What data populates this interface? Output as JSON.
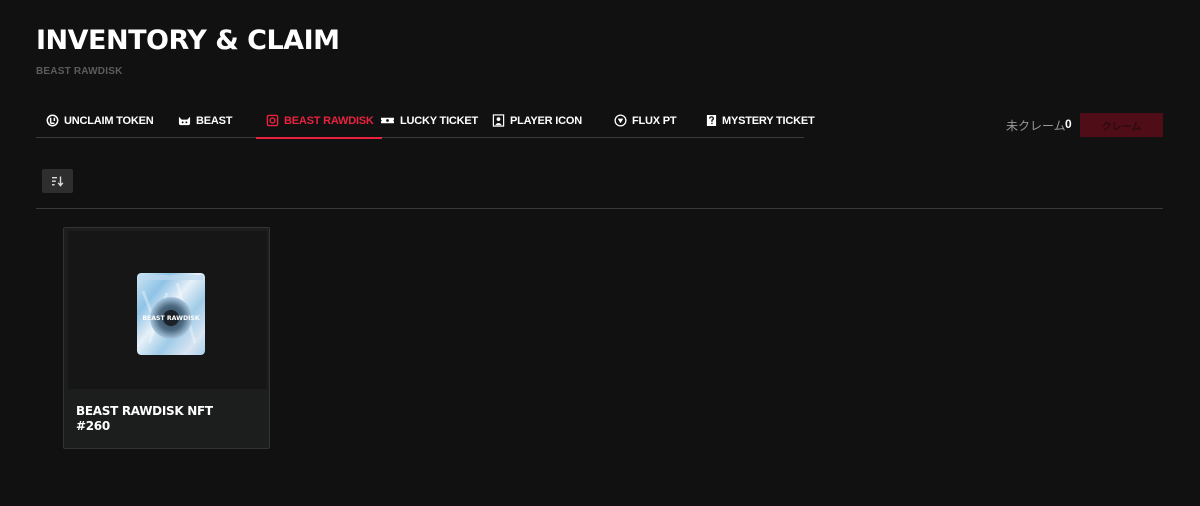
{
  "header": {
    "title": "INVENTORY & CLAIM",
    "subtitle": "BEAST RAWDISK"
  },
  "tabs": [
    {
      "label": "UNCLAIM TOKEN",
      "icon": "token-icon",
      "active": false
    },
    {
      "label": "BEAST",
      "icon": "cat-face-icon",
      "active": false
    },
    {
      "label": "BEAST RAWDISK",
      "icon": "disk-icon",
      "active": true
    },
    {
      "label": "LUCKY TICKET",
      "icon": "ticket-icon",
      "active": false
    },
    {
      "label": "PLAYER ICON",
      "icon": "player-icon",
      "active": false
    },
    {
      "label": "FLUX PT",
      "icon": "flux-icon",
      "active": false
    },
    {
      "label": "MYSTERY TICKET",
      "icon": "question-icon",
      "active": false
    }
  ],
  "claim": {
    "label": "未クレーム",
    "count": "0",
    "button_label": "クレーム"
  },
  "toolbar": {
    "sort_icon": "sort-icon"
  },
  "items": [
    {
      "title": "BEAST RAWDISK NFT",
      "number": "#260",
      "image_text": "BEAST RAWDISK"
    }
  ],
  "colors": {
    "background": "#111111",
    "accent": "#e8223f",
    "claim_button_bg": "#4f0d17",
    "card_bg": "#1c1d1d",
    "muted_text": "#5c5c5c"
  }
}
